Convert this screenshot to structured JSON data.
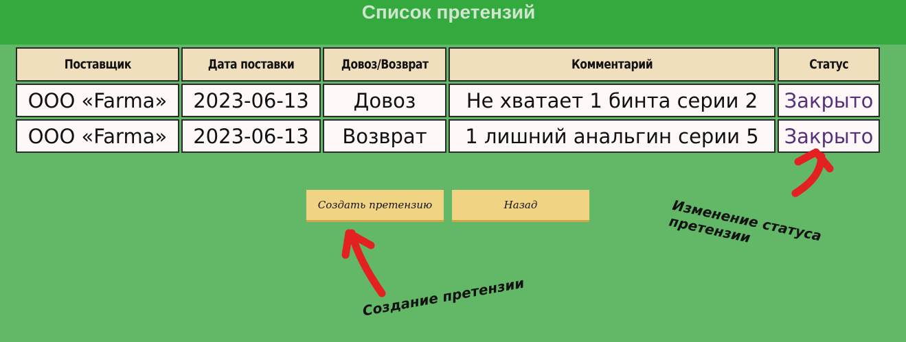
{
  "header": {
    "title": "Список претензий"
  },
  "table": {
    "columns": [
      "Поставщик",
      "Дата поставки",
      "Довоз/Возврат",
      "Комментарий",
      "Статус"
    ],
    "rows": [
      [
        "ООО «Farma»",
        "2023-06-13",
        "Довоз",
        "Не хватает 1 бинта серии 2",
        "Закрыто"
      ],
      [
        "ООО «Farma»",
        "2023-06-13",
        "Возврат",
        "1 лишний анальгин серии 5",
        "Закрыто"
      ]
    ]
  },
  "buttons": {
    "create_label": "Создать претензию",
    "back_label": "Назад"
  },
  "annotations": {
    "status_line1": "Изменение статуса",
    "status_line2": "претензии",
    "create": "Создание претензии"
  },
  "colors": {
    "background": "#62b866",
    "header": "#34a93d",
    "th_bg": "#efdfbd",
    "td_bg": "#fff8f8",
    "status_text": "#55317a",
    "button_bg": "#f0d383",
    "arrow": "#e32121"
  }
}
